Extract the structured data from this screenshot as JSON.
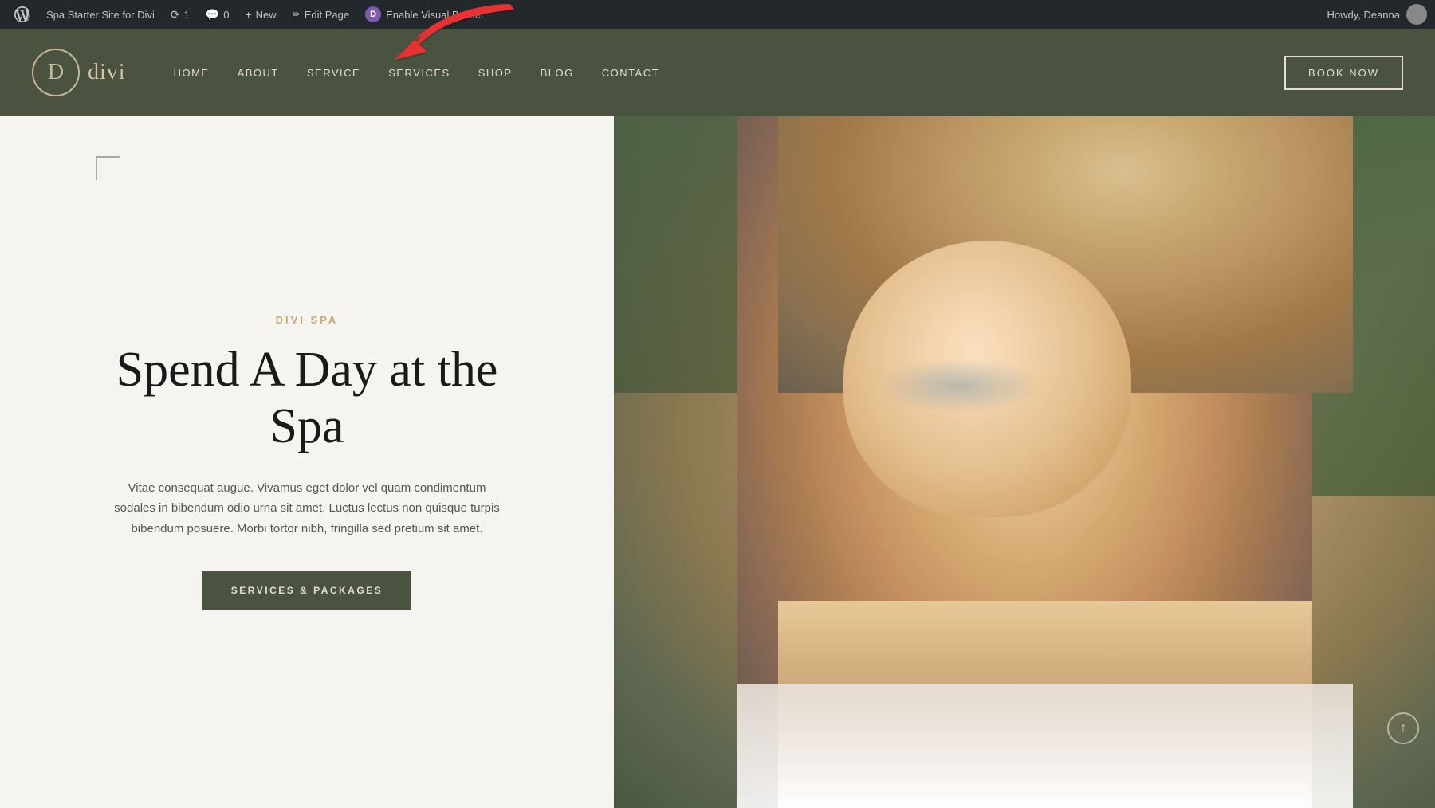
{
  "adminBar": {
    "siteTitle": "Spa Starter Site for Divi",
    "updates": "1",
    "comments": "0",
    "newLabel": "New",
    "editPageLabel": "Edit Page",
    "enableVisualBuilder": "Enable Visual Builder",
    "howdy": "Howdy, Deanna"
  },
  "nav": {
    "logoLetter": "D",
    "logoName": "divi",
    "items": [
      {
        "label": "HOME"
      },
      {
        "label": "ABOUT"
      },
      {
        "label": "SERVICE"
      },
      {
        "label": "SERVICES"
      },
      {
        "label": "SHOP"
      },
      {
        "label": "BLOG"
      },
      {
        "label": "CONTACT"
      }
    ],
    "bookNow": "BOOK NOW"
  },
  "hero": {
    "spaLabel": "DIVI SPA",
    "title": "Spend A Day at the Spa",
    "description": "Vitae consequat augue. Vivamus eget dolor vel quam condimentum sodales in bibendum odio urna sit amet. Luctus lectus non quisque turpis bibendum posuere. Morbi tortor nibh, fringilla sed pretium sit amet.",
    "ctaButton": "SERVICES & PACKAGES"
  },
  "colors": {
    "navBg": "#4a5240",
    "adminBg": "#23282d",
    "accent": "#c8a96e",
    "btnBg": "#4a5240",
    "contentBg": "#f5f4f0"
  }
}
